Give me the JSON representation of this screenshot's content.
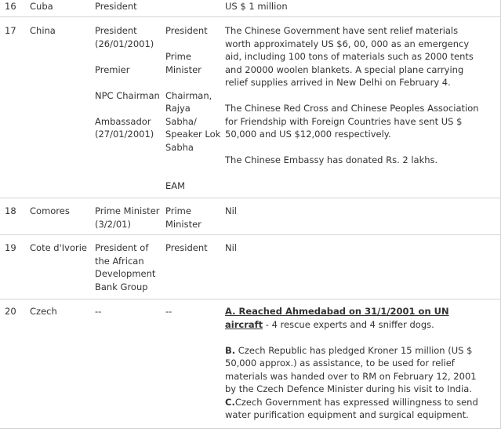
{
  "rows": {
    "r16": {
      "no": "16",
      "country": "Cuba",
      "level": "President",
      "recipient": "",
      "assistance": "US $ 1 million"
    },
    "r17": {
      "no": "17",
      "country": "China",
      "level": [
        "President\n(26/01/2001)",
        "Premier",
        "NPC Chairman",
        "Ambassador\n(27/01/2001)"
      ],
      "recipient": [
        "President",
        "Prime\nMinister",
        "Chairman,\nRajya\nSabha/\nSpeaker Lok\nSabha",
        "EAM"
      ],
      "assistance": [
        "The Chinese Government have sent relief materials worth approximately US $6, 00, 000 as an emergency aid, including 100 tons of materials such as 2000 tents and 20000 woolen blankets. A special plane carrying relief supplies arrived in New Delhi on February 4.",
        "The Chinese Red Cross and Chinese Peoples Association for Friendship with Foreign Countries have sent US $ 50,000 and US $12,000 respectively.",
        "The Chinese Embassy has donated Rs. 2 lakhs."
      ]
    },
    "r18": {
      "no": "18",
      "country": "Comores",
      "level": "Prime Minister\n(3/2/01)",
      "recipient": "Prime\nMinister",
      "assistance": "Nil"
    },
    "r19": {
      "no": "19",
      "country": "Cote d'Ivorie",
      "level": "President of\nthe African\nDevelopment\nBank Group",
      "recipient": "President",
      "assistance": "Nil"
    },
    "r20": {
      "no": "20",
      "country": "Czech",
      "level": "--",
      "recipient": "--",
      "assistance": {
        "a_link": "A. Reached Ahmedabad on 31/1/2001 on UN aircraft",
        "a_rest": " - 4 rescue experts and 4 sniffer dogs.",
        "b_label": "B.",
        "b_text": " Czech Republic has pledged Kroner 15 million (US $ 50,000 approx.) as assistance, to be used for relief materials was handed over to RM on February 12, 2001 by the Czech Defence Minister during his visit to India.",
        "c_label": "C.",
        "c_text": "Czech Government has expressed willingness to send water purification equipment and surgical equipment."
      }
    }
  }
}
